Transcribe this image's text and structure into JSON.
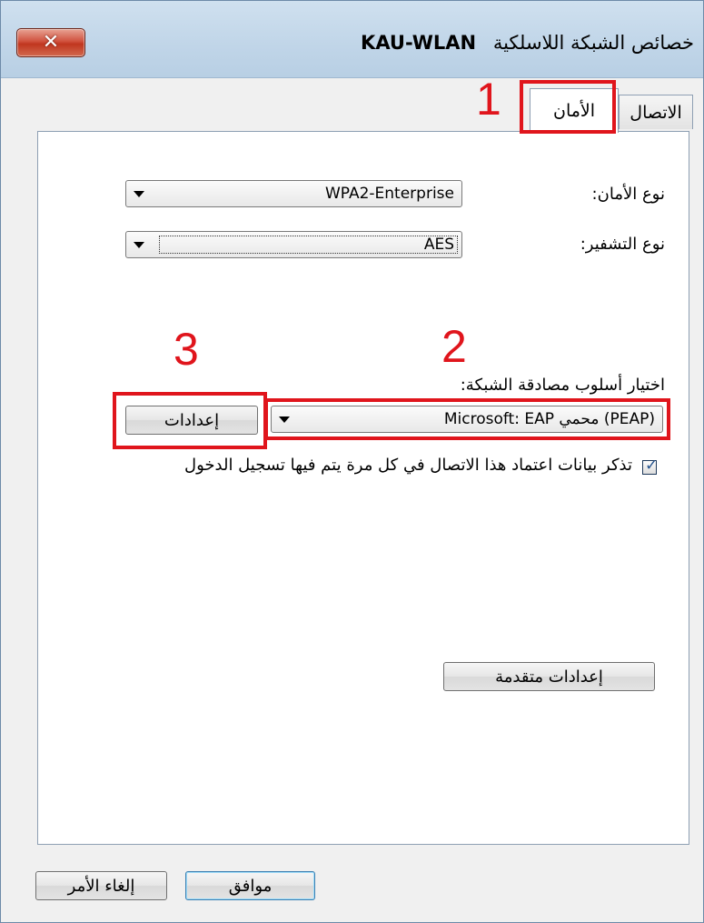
{
  "window": {
    "title_prefix": "خصائص الشبكة اللاسلكية",
    "ssid": "KAU-WLAN",
    "close_glyph": "✕"
  },
  "tabs": [
    {
      "label": "الاتصال",
      "active": false
    },
    {
      "label": "الأمان",
      "active": true
    }
  ],
  "security": {
    "security_type_label": "نوع الأمان:",
    "security_type_value": "WPA2-Enterprise",
    "encryption_type_label": "نوع التشفير:",
    "encryption_type_value": "AES",
    "auth_method_label": "اختيار أسلوب مصادقة الشبكة:",
    "auth_method_value": "Microsoft: EAP محمي (PEAP)",
    "settings_button": "إعدادات",
    "remember_label": "تذكر بيانات اعتماد هذا الاتصال في كل مرة يتم فيها تسجيل الدخول",
    "remember_checked": true,
    "advanced_button": "إعدادات متقدمة"
  },
  "footer": {
    "ok_button": "موافق",
    "cancel_button": "إلغاء الأمر"
  },
  "annotations": {
    "marker_1": "1",
    "marker_2": "2",
    "marker_3": "3",
    "color": "#e0151c"
  },
  "icons": {
    "dropdown": "chevron-down-icon",
    "close": "close-icon",
    "check": "checkmark-icon"
  }
}
